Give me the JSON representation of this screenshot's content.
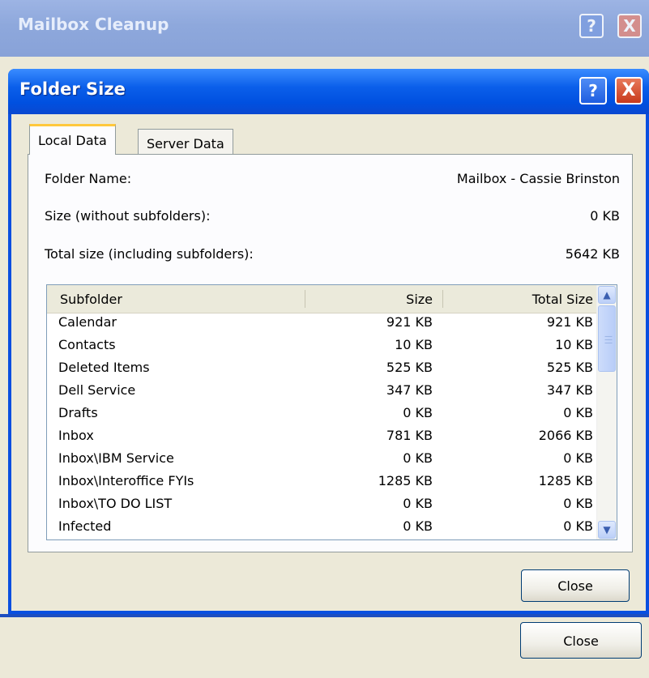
{
  "background_window": {
    "title": "Mailbox Cleanup",
    "help_label": "?",
    "close_label": "X",
    "close_button_label": "Close"
  },
  "dialog": {
    "title": "Folder Size",
    "help_label": "?",
    "close_label": "X",
    "tabs": [
      {
        "label": "Local Data",
        "active": true
      },
      {
        "label": "Server Data",
        "active": false
      }
    ],
    "folder_name_label": "Folder Name:",
    "folder_name_value": "Mailbox - Cassie Brinston",
    "size_label": "Size (without subfolders):",
    "size_value": "0 KB",
    "total_size_label": "Total size (including subfolders):",
    "total_size_value": "5642 KB",
    "list": {
      "columns": [
        "Subfolder",
        "Size",
        "Total Size"
      ],
      "rows": [
        {
          "name": "Calendar",
          "size": "921 KB",
          "total": "921 KB"
        },
        {
          "name": "Contacts",
          "size": "10 KB",
          "total": "10 KB"
        },
        {
          "name": "Deleted Items",
          "size": "525 KB",
          "total": "525 KB"
        },
        {
          "name": "Dell Service",
          "size": "347 KB",
          "total": "347 KB"
        },
        {
          "name": "Drafts",
          "size": "0 KB",
          "total": "0 KB"
        },
        {
          "name": "Inbox",
          "size": "781 KB",
          "total": "2066 KB"
        },
        {
          "name": "Inbox\\IBM Service",
          "size": "0 KB",
          "total": "0 KB"
        },
        {
          "name": "Inbox\\Interoffice FYIs",
          "size": "1285 KB",
          "total": "1285 KB"
        },
        {
          "name": "Inbox\\TO DO LIST",
          "size": "0 KB",
          "total": "0 KB"
        },
        {
          "name": "Infected",
          "size": "0 KB",
          "total": "0 KB"
        }
      ]
    },
    "close_button_label": "Close"
  },
  "icons": {
    "scroll_up": "chevron-up-icon",
    "scroll_down": "chevron-down-icon",
    "scroll_grip": "grip-icon"
  },
  "colors": {
    "titlebar_blue": "#0b5fea",
    "window_face": "#ece9d8",
    "close_red": "#c83a1c",
    "active_tab_accent": "#ffc83c"
  }
}
